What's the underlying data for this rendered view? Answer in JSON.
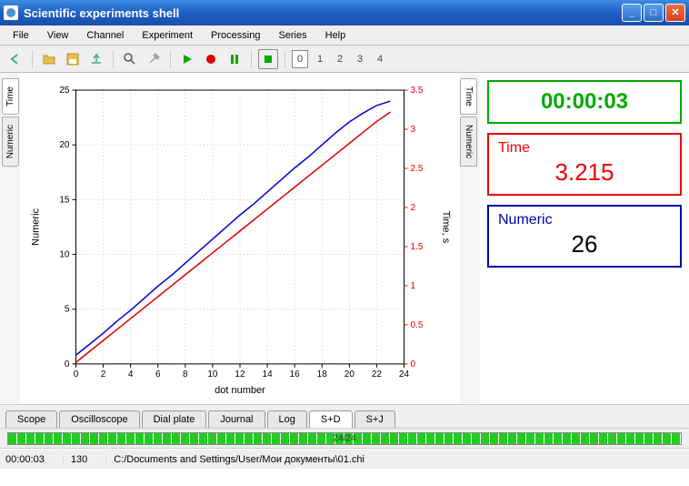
{
  "window": {
    "title": "Scientific experiments shell"
  },
  "menu": {
    "items": [
      "File",
      "View",
      "Channel",
      "Experiment",
      "Processing",
      "Series",
      "Help"
    ]
  },
  "toolbar": {
    "numbers": [
      "0",
      "1",
      "2",
      "3",
      "4"
    ]
  },
  "side_tabs": {
    "left": [
      "Time",
      "Numeric"
    ],
    "right": [
      "Time",
      "Numeric"
    ]
  },
  "panels": {
    "elapsed": {
      "value": "00:00:03"
    },
    "time": {
      "label": "Time",
      "value": "3.215"
    },
    "numeric": {
      "label": "Numeric",
      "value": "26"
    }
  },
  "bottom_tabs": [
    "Scope",
    "Oscilloscope",
    "Dial plate",
    "Journal",
    "Log",
    "S+D",
    "S+J"
  ],
  "bottom_active": "S+D",
  "progress": {
    "text": "24/24"
  },
  "status": {
    "time": "00:00:03",
    "count": "130",
    "path": "C:/Documents and Settings/User/Мои документы\\01.chi"
  },
  "chart_data": {
    "type": "line",
    "title": "",
    "xlabel": "dot number",
    "ylabel_left": "Numeric",
    "ylabel_right": "Time, s",
    "xlim": [
      0,
      24
    ],
    "ylim_left": [
      0,
      25
    ],
    "ylim_right": [
      0,
      3.5
    ],
    "xticks": [
      0,
      2,
      4,
      6,
      8,
      10,
      12,
      14,
      16,
      18,
      20,
      22,
      24
    ],
    "yticks_left": [
      0,
      5,
      10,
      15,
      20,
      25
    ],
    "yticks_right": [
      0,
      0.5,
      1,
      1.5,
      2,
      2.5,
      3,
      3.5
    ],
    "series": [
      {
        "name": "Numeric",
        "color": "#0000cc",
        "axis": "left",
        "x": [
          0,
          1,
          2,
          3,
          4,
          5,
          6,
          7,
          8,
          9,
          10,
          11,
          12,
          13,
          14,
          15,
          16,
          17,
          18,
          19,
          20,
          21,
          22,
          23
        ],
        "y": [
          0.8,
          1.8,
          2.8,
          3.9,
          4.9,
          6.0,
          7.1,
          8.1,
          9.2,
          10.3,
          11.4,
          12.5,
          13.6,
          14.6,
          15.7,
          16.8,
          17.9,
          18.9,
          20.0,
          21.1,
          22.1,
          22.9,
          23.6,
          24.0
        ]
      },
      {
        "name": "Time",
        "color": "#dd0000",
        "axis": "right",
        "x": [
          0,
          1,
          2,
          3,
          4,
          5,
          6,
          7,
          8,
          9,
          10,
          11,
          12,
          13,
          14,
          15,
          16,
          17,
          18,
          19,
          20,
          21,
          22,
          23
        ],
        "y": [
          0.02,
          0.16,
          0.3,
          0.44,
          0.58,
          0.72,
          0.86,
          1.0,
          1.14,
          1.28,
          1.42,
          1.56,
          1.7,
          1.84,
          1.98,
          2.12,
          2.26,
          2.4,
          2.54,
          2.68,
          2.82,
          2.96,
          3.1,
          3.22
        ]
      }
    ]
  }
}
